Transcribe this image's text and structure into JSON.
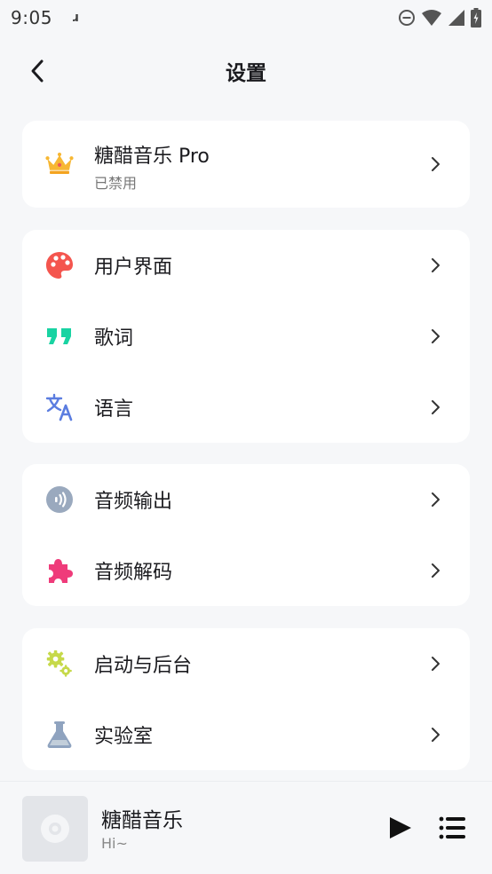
{
  "status_bar": {
    "time": "9:05",
    "notification": "ɹ"
  },
  "app_bar": {
    "title": "设置",
    "back_icon": "arrow-back-icon"
  },
  "sections": {
    "pro": {
      "title": "糖醋音乐 Pro",
      "subtitle": "已禁用",
      "icon": "crown-icon"
    },
    "interface": [
      {
        "label": "用户界面",
        "icon": "palette-icon"
      },
      {
        "label": "歌词",
        "icon": "quote-icon"
      },
      {
        "label": "语言",
        "icon": "translate-icon"
      }
    ],
    "audio": [
      {
        "label": "音频输出",
        "icon": "audio-output-icon"
      },
      {
        "label": "音频解码",
        "icon": "puzzle-icon"
      }
    ],
    "system": [
      {
        "label": "启动与后台",
        "icon": "gears-icon"
      },
      {
        "label": "实验室",
        "icon": "flask-icon"
      }
    ]
  },
  "mini_player": {
    "title": "糖醋音乐",
    "subtitle": "Hi~",
    "play_icon": "play-icon",
    "queue_icon": "queue-icon"
  },
  "colors": {
    "background": "#f6f7f9",
    "card": "#ffffff",
    "crown": "#f7b733",
    "palette": "#f4554e",
    "quote": "#19d3a2",
    "translate": "#5b7de0",
    "audio_output": "#9aa9be",
    "puzzle": "#ef3b7a",
    "gears": "#c6d94a",
    "flask": "#8fa3bf"
  }
}
